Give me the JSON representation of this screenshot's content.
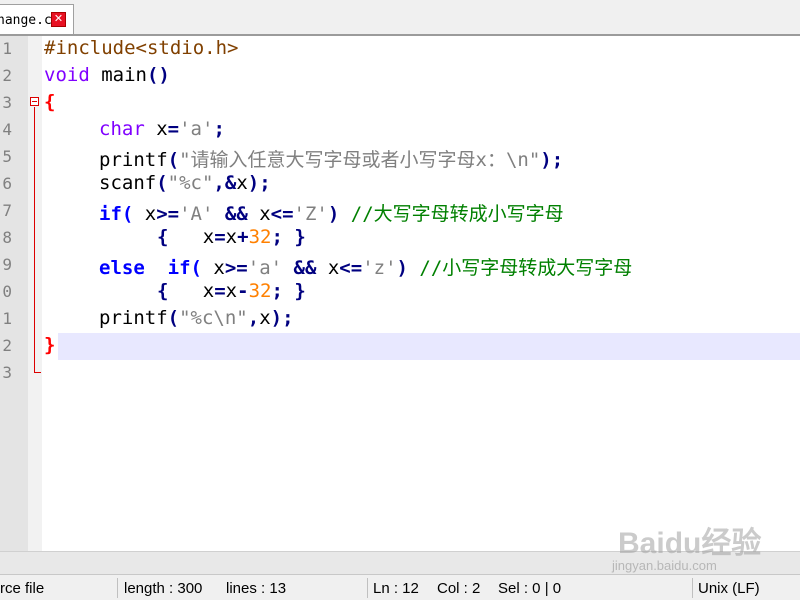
{
  "tab": {
    "title": "hange.c",
    "close_glyph": "✕"
  },
  "line_numbers": [
    "1",
    "2",
    "3",
    "4",
    "5",
    "6",
    "7",
    "8",
    "9",
    "0",
    "1",
    "2",
    "3"
  ],
  "code": {
    "l1_a": "#include<stdio.h>",
    "l2_a": "void",
    "l2_b": " main",
    "l2_c": "()",
    "l3_a": "{",
    "l4_a": "char",
    "l4_b": " x",
    "l4_c": "=",
    "l4_d": "'a'",
    "l4_e": ";",
    "l5_a": "printf",
    "l5_b": "(",
    "l5_c": "\"请输入任意大写字母或者小写字母x：\\n\"",
    "l5_d": ");",
    "l6_a": "scanf",
    "l6_b": "(",
    "l6_c": "\"%c\"",
    "l6_d": ",&",
    "l6_e": "x",
    "l6_f": ");",
    "l7_a": "if(",
    "l7_b": " x",
    "l7_c": ">=",
    "l7_d": "'A'",
    "l7_e": " &&",
    "l7_f": " x",
    "l7_g": "<=",
    "l7_h": "'Z'",
    "l7_i": ")",
    "l7_j": " //大写字母转成小写字母",
    "l8_a": "{",
    "l8_b": "   x",
    "l8_c": "=",
    "l8_d": "x",
    "l8_e": "+",
    "l8_f": "32",
    "l8_g": ";",
    "l8_h": " }",
    "l9_a": "else",
    "l9_b": "  if(",
    "l9_c": " x",
    "l9_d": ">=",
    "l9_e": "'a'",
    "l9_f": " &&",
    "l9_g": " x",
    "l9_h": "<=",
    "l9_i": "'z'",
    "l9_j": ")",
    "l9_k": " //小写字母转成大写字母",
    "l10_a": "{",
    "l10_b": "   x",
    "l10_c": "=",
    "l10_d": "x",
    "l10_e": "-",
    "l10_f": "32",
    "l10_g": ";",
    "l10_h": " }",
    "l11_a": "printf",
    "l11_b": "(",
    "l11_c": "\"%c\\n\"",
    "l11_d": ",",
    "l11_e": "x",
    "l11_f": ");",
    "l12_a": "}"
  },
  "status": {
    "file_type": "rce file",
    "length": "length : 300",
    "lines": "lines : 13",
    "ln": "Ln : 12",
    "col": "Col : 2",
    "sel": "Sel : 0 | 0",
    "eol": "Unix (LF)"
  },
  "watermark": {
    "brand": "Bai",
    "brand2": "du",
    "cn": "经验",
    "url": "jingyan.baidu.com"
  },
  "colors": {
    "keyword": "#0000ff",
    "type": "#8000ff",
    "string": "#808080",
    "number": "#ff8000",
    "comment": "#008000",
    "current_line": "#e8e8ff",
    "fold": "#dc0000"
  }
}
